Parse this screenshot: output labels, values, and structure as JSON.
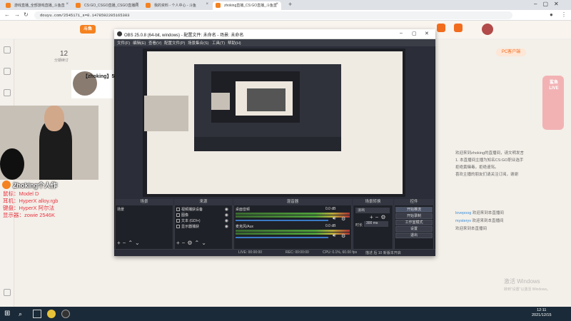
{
  "browser": {
    "tabs": [
      {
        "label": "游戏直播_全部游戏直播_斗鱼直"
      },
      {
        "label": "CS:GO_CSGO直播_CSGO直播网"
      },
      {
        "label": "我的资料 - 个人中心 - 斗鱼"
      },
      {
        "label": "zhoking直播_CS:GO直播_斗鱼直"
      }
    ],
    "new_tab": "+",
    "url": "douyu.com/2545171_s=0.1478592205165303"
  },
  "site": {
    "logo": "斗鱼",
    "stat_number": "12",
    "stat_label": "分期续订",
    "streamer_name": "【zhoking】5",
    "gift_button": "PC客户端",
    "promo_text": "鲨鱼 LIVE",
    "chat_lines": [
      {
        "user": "",
        "text": "欢迎来到zhoking的直播间，请文明发言"
      },
      {
        "user": "",
        "text": "1. 本直播间主播为知名CS:GO职业选手"
      },
      {
        "user": "",
        "text": "拒绝黄赌毒，拒绝谩骂。"
      },
      {
        "user": "",
        "text": "喜欢主播的朋友们请关注订阅，谢谢"
      },
      {
        "user": "lovepoog",
        "text": "欢迎来到本直播间"
      },
      {
        "user": "mysteryv",
        "text": "欢迎来到本直播间"
      },
      {
        "user": "",
        "text": "欢迎来到本直播间"
      }
    ]
  },
  "webcam": {
    "name": "Zhoking个人作",
    "specs": [
      "鼠标：Model D",
      "耳机：HyperX alloy.rgb",
      "键盘：HyperX 阿尔法",
      "显示器：zowie 2546K"
    ]
  },
  "obs": {
    "title": "OBS 25.0.8 (64-bit, windows) - 配置文件: 未命名 - 场景: 未命名",
    "menu": [
      "文件(F)",
      "编辑(E)",
      "查看(V)",
      "配置文件(P)",
      "场景集合(S)",
      "工具(T)",
      "帮助(H)"
    ],
    "docks": {
      "scenes_title": "场景",
      "sources_title": "来源",
      "mixer_title": "混音器",
      "transitions_title": "场景转换",
      "controls_title": "控件"
    },
    "scenes": [
      "场景"
    ],
    "sources": [
      "视频捕获设备",
      "图像",
      "文本 (GDI+)",
      "显示器捕获"
    ],
    "mixer": [
      {
        "label": "桌面音频",
        "db": "0.0 dB"
      },
      {
        "label": "麦克风/Aux",
        "db": "0.0 dB"
      }
    ],
    "transition": {
      "type": "淡出",
      "duration_label": "时长",
      "duration": "300 ms"
    },
    "controls": [
      "开始推流",
      "开始录制",
      "工作室模式",
      "设置",
      "退出"
    ],
    "status": {
      "live": "LIVE: 00:00:00",
      "rec": "REC: 00:00:00",
      "cpu": "CPU: 0.1%, 60.00 fps",
      "extra": "描述 后 10 新版本开启"
    }
  },
  "watermark": {
    "line1": "激活 Windows",
    "line2": "转到“设置”以激活 Windows。"
  },
  "taskbar": {
    "time": "12:11",
    "date": "2021/12/15"
  }
}
